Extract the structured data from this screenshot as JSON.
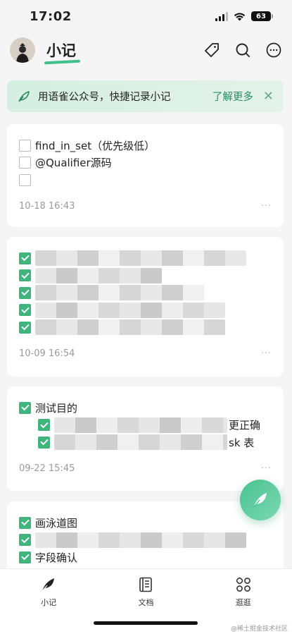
{
  "status_bar": {
    "time": "17:02",
    "battery": "63"
  },
  "header": {
    "title": "小记"
  },
  "banner": {
    "text": "用语雀公众号，快捷记录小记",
    "link": "了解更多"
  },
  "cards": [
    {
      "items": [
        {
          "text": "find_in_set（优先级低）",
          "checked": false
        },
        {
          "text": "@Qualifier源码",
          "checked": false
        },
        {
          "text": "",
          "checked": false
        }
      ],
      "timestamp": "10-18 16:43"
    },
    {
      "timestamp": "10-09 16:54"
    },
    {
      "items": [
        {
          "text": "测试目的",
          "checked": true
        },
        {
          "text": "更正确",
          "checked": true
        },
        {
          "text": "sk 表",
          "checked": true
        }
      ],
      "timestamp": "09-22 15:45"
    },
    {
      "items": [
        {
          "text": "画泳道图",
          "checked": true
        },
        {
          "text": "字段确认",
          "checked": true
        }
      ]
    }
  ],
  "tabs": [
    {
      "label": "小记",
      "icon": "feather-icon"
    },
    {
      "label": "文档",
      "icon": "book-icon"
    },
    {
      "label": "逛逛",
      "icon": "grid-icon"
    }
  ],
  "watermark": "@稀土掘金技术社区",
  "colors": {
    "accent": "#3fb57d",
    "banner_bg": "#d5efe2",
    "link": "#2a8b64"
  }
}
